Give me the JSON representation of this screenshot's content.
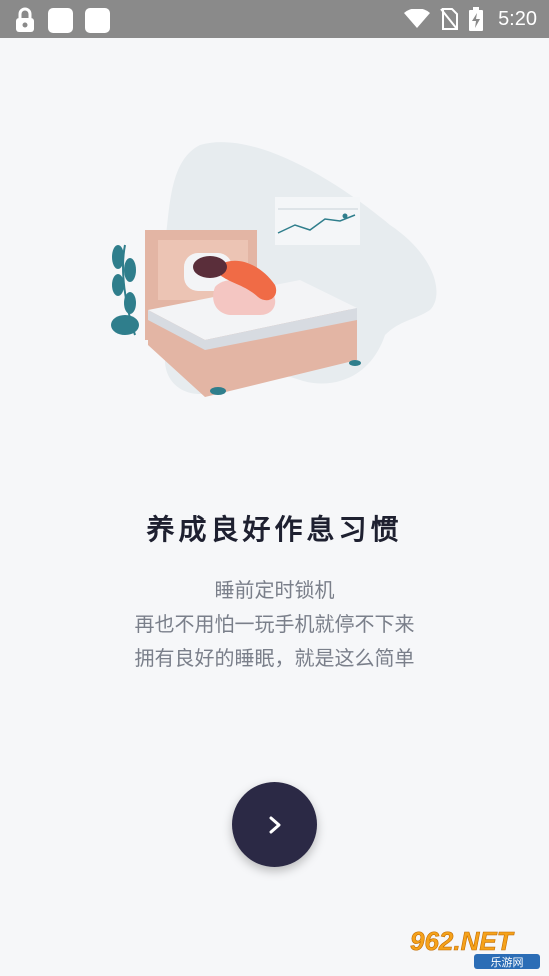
{
  "status_bar": {
    "time": "5:20",
    "icons": [
      "lock-icon",
      "notification-square-icon",
      "notification-square-icon",
      "wifi-icon",
      "no-sim-icon",
      "battery-charging-icon"
    ]
  },
  "onboarding": {
    "title": "养成良好作息习惯",
    "lines": [
      "睡前定时锁机",
      "再也不用怕一玩手机就停不下来",
      "拥有良好的睡眠，就是这么简单"
    ],
    "next_icon": "chevron-right-icon"
  },
  "watermark": {
    "brand": "962.NET",
    "sub": "乐游网"
  },
  "colors": {
    "background": "#f6f7f9",
    "status_bar": "#8a8a8a",
    "button": "#2b2945",
    "title": "#1e2030",
    "description": "#7a7f8a"
  }
}
